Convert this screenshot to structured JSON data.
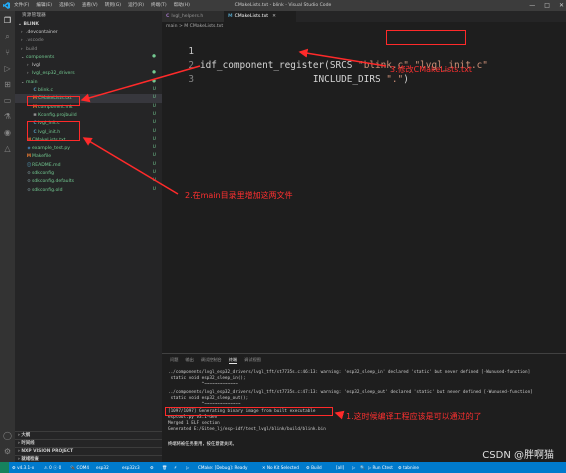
{
  "window": {
    "title": "CMakeLists.txt - blink - Visual Studio Code",
    "menu": [
      "文件(F)",
      "编辑(E)",
      "选择(S)",
      "查看(V)",
      "转到(G)",
      "运行(R)",
      "终端(T)",
      "帮助(H)"
    ],
    "controls": [
      "—",
      "□",
      "✕"
    ]
  },
  "sidebar": {
    "header": "资源管理器",
    "section": "BLINK",
    "tree": [
      {
        "label": ".devcontainer",
        "indent": 1,
        "chev": "›",
        "icon": "",
        "color": "#cccccc",
        "badge": ""
      },
      {
        "label": ".vscode",
        "indent": 1,
        "chev": "›",
        "icon": "",
        "color": "#8c8c8c",
        "badge": ""
      },
      {
        "label": "build",
        "indent": 1,
        "chev": "›",
        "icon": "",
        "color": "#8c8c8c",
        "badge": ""
      },
      {
        "label": "components",
        "indent": 1,
        "chev": "⌄",
        "icon": "",
        "color": "#73c991",
        "badge": "●"
      },
      {
        "label": "lvgl",
        "indent": 2,
        "chev": "›",
        "icon": "",
        "color": "#cccccc",
        "badge": ""
      },
      {
        "label": "lvgl_esp32_drivers",
        "indent": 2,
        "chev": "›",
        "icon": "",
        "color": "#73c991",
        "badge": "●"
      },
      {
        "label": "main",
        "indent": 1,
        "chev": "⌄",
        "icon": "",
        "color": "#73c991",
        "badge": "●"
      },
      {
        "label": "blink.c",
        "indent": 2,
        "chev": "",
        "icon": "C",
        "color": "#73c991",
        "badge": "U"
      },
      {
        "label": "CMakeLists.txt",
        "indent": 2,
        "chev": "",
        "icon": "M",
        "color": "#73c991",
        "badge": "U",
        "selected": true
      },
      {
        "label": "component.mk",
        "indent": 2,
        "chev": "",
        "icon": "M",
        "color": "#73c991",
        "badge": "U"
      },
      {
        "label": "Kconfig.projbuild",
        "indent": 2,
        "chev": "",
        "icon": "≡",
        "color": "#73c991",
        "badge": "U"
      },
      {
        "label": "lvgl_init.c",
        "indent": 2,
        "chev": "",
        "icon": "C",
        "color": "#73c991",
        "badge": "U"
      },
      {
        "label": "lvgl_init.h",
        "indent": 2,
        "chev": "",
        "icon": "C",
        "color": "#73c991",
        "badge": "U"
      },
      {
        "label": "CMakeLists.txt",
        "indent": 1,
        "chev": "",
        "icon": "M",
        "color": "#73c991",
        "badge": "U"
      },
      {
        "label": "example_test.py",
        "indent": 1,
        "chev": "",
        "icon": "◆",
        "color": "#73c991",
        "badge": "U"
      },
      {
        "label": "Makefile",
        "indent": 1,
        "chev": "",
        "icon": "M",
        "color": "#73c991",
        "badge": "U"
      },
      {
        "label": "README.md",
        "indent": 1,
        "chev": "",
        "icon": "ⓘ",
        "color": "#73c991",
        "badge": "U"
      },
      {
        "label": "sdkconfig",
        "indent": 1,
        "chev": "",
        "icon": "⚙",
        "color": "#73c991",
        "badge": "U"
      },
      {
        "label": "sdkconfig.defaults",
        "indent": 1,
        "chev": "",
        "icon": "⚙",
        "color": "#73c991",
        "badge": "U"
      },
      {
        "label": "sdkconfig.old",
        "indent": 1,
        "chev": "",
        "icon": "⚙",
        "color": "#73c991",
        "badge": "U"
      }
    ],
    "bottom_sections": [
      "大纲",
      "时间线",
      "NXP VISION PROJECT",
      "就绪检查"
    ]
  },
  "tabs": [
    {
      "label": "lvgl_helpers.h",
      "icon": "C",
      "active": false
    },
    {
      "label": "CMakeLists.txt",
      "icon": "M",
      "active": true
    }
  ],
  "breadcrumb": "main > M CMakeLists.txt",
  "editor": {
    "lines": [
      {
        "no": "1",
        "pre": "idf_component_register(SRCS ",
        "s1": "\"blink.c\"",
        "mid": " ",
        "s2": "\"lvgl_init.c\"",
        "post": ""
      },
      {
        "no": "2",
        "pre": "                    INCLUDE_DIRS ",
        "s1": "\".\"",
        "mid": ")",
        "s2": "",
        "post": ""
      },
      {
        "no": "3",
        "pre": "",
        "s1": "",
        "mid": "",
        "s2": "",
        "post": ""
      }
    ]
  },
  "panel": {
    "tabs": [
      "问题",
      "输出",
      "调试控制台",
      "终端",
      "调试视图"
    ],
    "active_tab": "终端",
    "lines": [
      "../components/lvgl_esp32_drivers/lvgl_tft/st7735s.c:46:13: warning: 'esp32_sleep_in' declared 'static' but never defined [-Wunused-function]",
      " static void esp32_sleep_in();",
      "             ^~~~~~~~~~~~~~",
      "../components/lvgl_esp32_drivers/lvgl_tft/st7735s.c:47:13: warning: 'esp32_sleep_out' declared 'static' but never defined [-Wunused-function]",
      " static void esp32_sleep_out();",
      "             ^~~~~~~~~~~~~~~",
      "[1097/1097] Generating binary image from built executable",
      "esptool.py v3.1-dev",
      "Merged 1 ELF section",
      "Generated E:/Gitee_lj/esp-idf/test_lvgl/blink/build/blink.bin",
      "",
      "终端将被任务重用，按任意键关闭。"
    ]
  },
  "statusbar": {
    "items": [
      "⚙ v4.3.1-x",
      "⚠ 0 ⓧ 0",
      "🔌 COM4",
      "esp32",
      "esp32c3",
      "⚙",
      "🗑",
      "⚡",
      "▷",
      "CMake: [Debug]: Ready",
      "✕ No Kit Selected",
      "⚙ Build",
      "[all]",
      "▷",
      "🔍",
      "▷ Run Ctest",
      "⚙ tabnine"
    ]
  },
  "annotations": {
    "a1": "3.修改CMakeLists.txt",
    "a2": "2.在main目录里增加这两文件",
    "a3": "1.这时候编译工程应该是可以通过的了",
    "color": "#ff2a2a"
  },
  "watermark": "CSDN @胖啊猫"
}
